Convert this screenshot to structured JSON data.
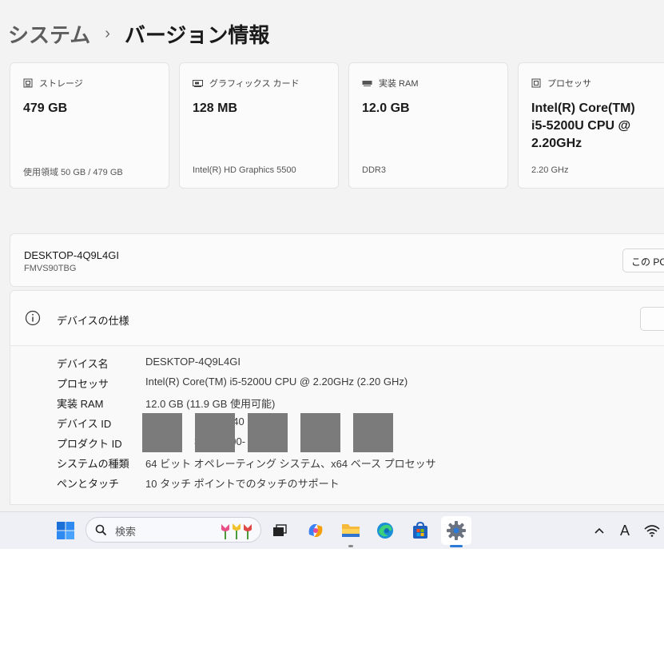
{
  "breadcrumb": {
    "parent": "システム",
    "separator": "›",
    "current": "バージョン情報"
  },
  "cards": [
    {
      "label": "ストレージ",
      "value": "479 GB",
      "sub": "使用領域 50 GB / 479 GB",
      "icon": "storage-icon"
    },
    {
      "label": "グラフィックス カード",
      "value": "128 MB",
      "sub": "Intel(R) HD Graphics 5500",
      "icon": "graphics-card-icon"
    },
    {
      "label": "実装 RAM",
      "value": "12.0 GB",
      "sub": "DDR3",
      "icon": "ram-icon"
    },
    {
      "label": "プロセッサ",
      "value_lines": [
        "Intel(R) Core(TM)",
        "i5-5200U CPU @",
        "2.20GHz"
      ],
      "sub": "2.20 GHz",
      "icon": "processor-icon"
    }
  ],
  "device": {
    "name": "DESKTOP-4Q9L4GI",
    "model": "FMVS90TBG",
    "rename_label": "この PC"
  },
  "specs": {
    "title": "デバイスの仕様",
    "rows": [
      {
        "key": "デバイス名",
        "value": "DESKTOP-4Q9L4GI"
      },
      {
        "key": "プロセッサ",
        "value": "Intel(R) Core(TM) i5-5200U CPU @ 2.20GHz (2.20 GHz)"
      },
      {
        "key": "実装 RAM",
        "value": "12.0 GB (11.9 GB 使用可能)"
      },
      {
        "key": "デバイス ID",
        "value": "EA  40  C6  BC"
      },
      {
        "key": "プロダクト ID",
        "value": "300  00-"
      },
      {
        "key": "システムの種類",
        "value": "64 ビット オペレーティング システム、x64 ベース プロセッサ"
      },
      {
        "key": "ペンとタッチ",
        "value": "10 タッチ ポイントでのタッチのサポート"
      }
    ]
  },
  "taskbar": {
    "search_placeholder": "検索",
    "tray_font_label": "A",
    "icons": [
      "windows-start-icon",
      "search-icon",
      "tulips-icon",
      "task-view-icon",
      "copilot-icon",
      "file-explorer-icon",
      "edge-icon",
      "store-icon",
      "settings-icon",
      "chevron-up-icon",
      "wifi-icon"
    ]
  },
  "colors": {
    "accent": "#2b7bd6",
    "background": "#f3f3f3",
    "card": "#fbfbfb",
    "redaction": "#7b7b7b"
  }
}
